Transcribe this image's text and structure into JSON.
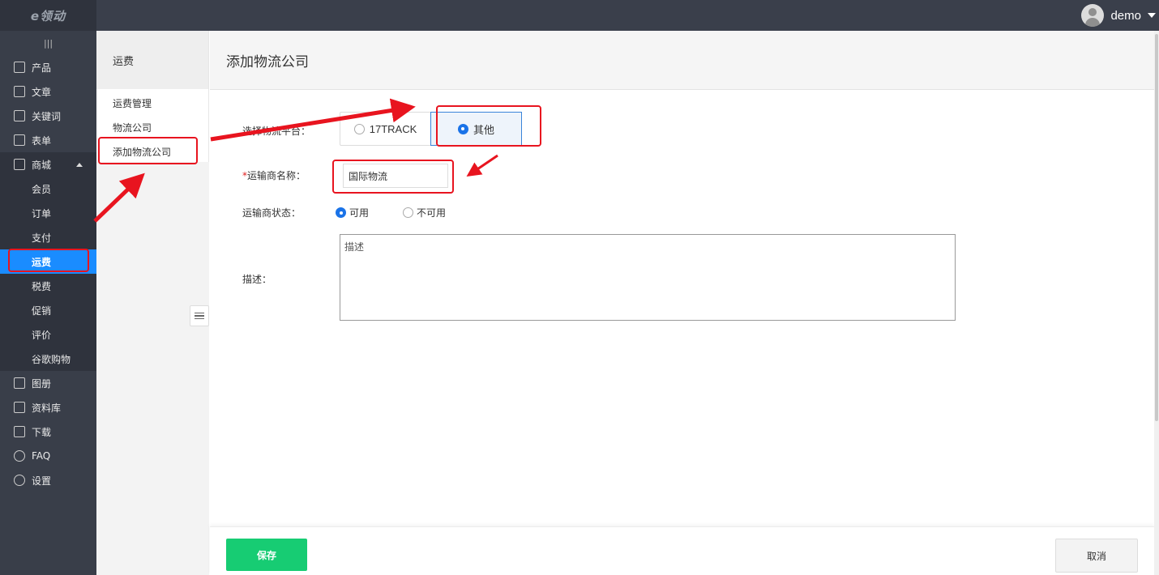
{
  "brand": {
    "logo_text": "e领动"
  },
  "user": {
    "name": "demo"
  },
  "sidebar": {
    "collapse_icon": "|||",
    "items": [
      {
        "label": "产品",
        "icon": "grid-icon"
      },
      {
        "label": "文章",
        "icon": "article-icon"
      },
      {
        "label": "关键词",
        "icon": "keyword-icon"
      },
      {
        "label": "表单",
        "icon": "form-icon"
      },
      {
        "label": "商城",
        "icon": "shop-icon"
      }
    ],
    "shop_children": [
      "会员",
      "订单",
      "支付",
      "运费",
      "税费",
      "促销",
      "评价",
      "谷歌购物"
    ],
    "bottom_items": [
      {
        "label": "图册",
        "icon": "album-icon"
      },
      {
        "label": "资料库",
        "icon": "library-icon"
      },
      {
        "label": "下载",
        "icon": "download-icon"
      },
      {
        "label": "FAQ",
        "icon": "faq-icon"
      },
      {
        "label": "设置",
        "icon": "settings-icon"
      }
    ]
  },
  "subnav": {
    "title": "运费",
    "items": [
      "运费管理",
      "物流公司",
      "添加物流公司"
    ]
  },
  "main": {
    "title": "添加物流公司",
    "platform_label": "选择物流平台：",
    "platform_options": [
      "17TRACK",
      "其他"
    ],
    "platform_selected": "其他",
    "carrier_name_label": "运输商名称：",
    "carrier_name_required": "*",
    "carrier_name_value": "国际物流",
    "status_label": "运输商状态：",
    "status_options": [
      "可用",
      "不可用"
    ],
    "status_selected": "可用",
    "desc_label": "描述：",
    "desc_value": "描述"
  },
  "footer": {
    "save_label": "保存",
    "cancel_label": "取消"
  },
  "colors": {
    "accent": "#1a8cff",
    "save": "#17cc73",
    "annotation": "#e8141f",
    "sidebar_bg": "#393e49"
  }
}
